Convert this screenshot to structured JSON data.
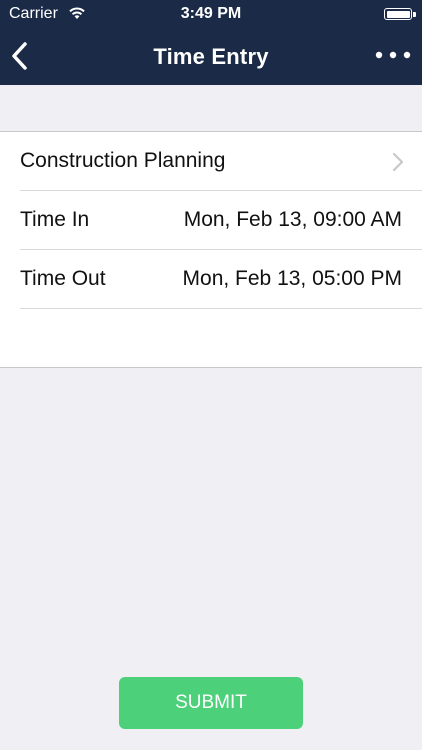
{
  "status_bar": {
    "carrier": "Carrier",
    "time": "3:49 PM",
    "wifi_icon": "wifi-icon",
    "battery_icon": "battery-icon"
  },
  "nav": {
    "title": "Time Entry",
    "back_icon": "chevron-left-icon",
    "more_icon": "more-horizontal-icon"
  },
  "entry": {
    "project": "Construction Planning",
    "time_in_label": "Time In",
    "time_in_value": "Mon, Feb 13, 09:00 AM",
    "time_out_label": "Time Out",
    "time_out_value": "Mon, Feb 13, 05:00 PM"
  },
  "actions": {
    "submit_label": "SUBMIT"
  },
  "colors": {
    "nav_background": "#1b2b47",
    "submit_green": "#4cd07a",
    "page_background": "#efeff4"
  }
}
